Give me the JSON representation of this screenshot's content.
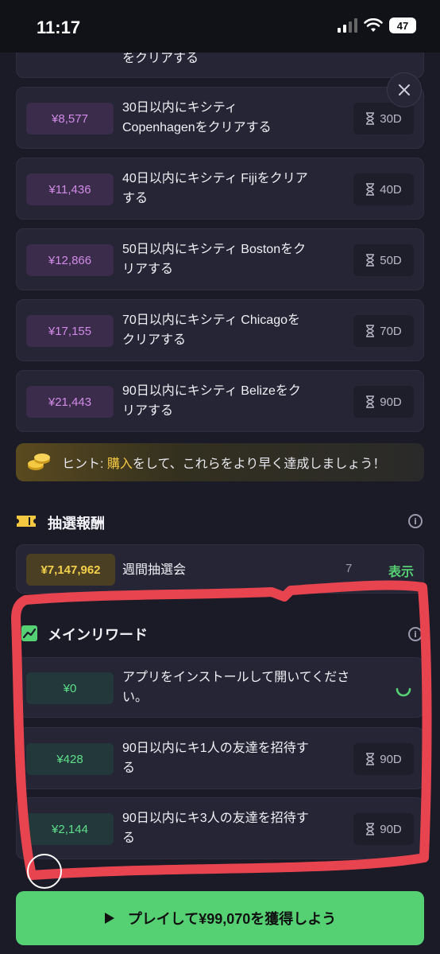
{
  "status": {
    "time": "11:17",
    "battery": "47"
  },
  "top_partial_card": {
    "text": "をクリアする"
  },
  "tasks": [
    {
      "price": "¥8,577",
      "line1": "30日以内にキシティ",
      "line2": "Copenhagenをクリアする",
      "days": "30D"
    },
    {
      "price": "¥11,436",
      "line1": "40日以内にキシティ Fijiをクリア",
      "line2": "する",
      "days": "40D"
    },
    {
      "price": "¥12,866",
      "line1": "50日以内にキシティ Bostonをク",
      "line2": "リアする",
      "days": "50D"
    },
    {
      "price": "¥17,155",
      "line1": "70日以内にキシティ Chicagoを",
      "line2": "クリアする",
      "days": "70D"
    },
    {
      "price": "¥21,443",
      "line1": "90日以内にキシティ Belizeをク",
      "line2": "リアする",
      "days": "90D"
    }
  ],
  "hint": {
    "prefix": "ヒント: ",
    "highlight": "購入",
    "suffix": "をして、これらをより早く達成しましょう！"
  },
  "lottery": {
    "title": "抽選報酬",
    "amount": "¥7,147,962",
    "label": "週間抽選会",
    "days": "7",
    "show_link": "表示"
  },
  "main_rewards": {
    "title": "メインリワード",
    "items": [
      {
        "price": "¥0",
        "line1": "アプリをインストールして開いてくださ",
        "line2": "い。"
      },
      {
        "price": "¥428",
        "line1": "90日以内にキ1人の友達を招待す",
        "line2": "る",
        "days": "90D"
      },
      {
        "price": "¥2,144",
        "line1": "90日以内にキ3人の友達を招待す",
        "line2": "る",
        "days": "90D"
      }
    ]
  },
  "play_button": {
    "label": "プレイして¥99,070を獲得しよう"
  },
  "colors": {
    "accent_green": "#55d073",
    "price_purple": "#d28be8",
    "annotation_red": "#e8444f"
  }
}
